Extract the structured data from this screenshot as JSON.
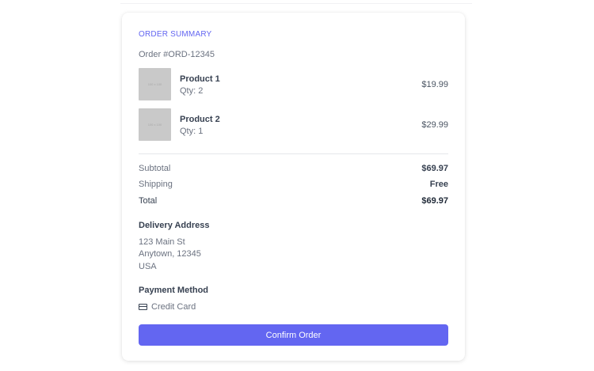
{
  "summary": {
    "heading": "ORDER SUMMARY",
    "order_id": "Order #ORD-12345"
  },
  "items": [
    {
      "name": "Product 1",
      "qty": "Qty: 2",
      "price": "$19.99",
      "thumb_text": "100 x 100"
    },
    {
      "name": "Product 2",
      "qty": "Qty: 1",
      "price": "$29.99",
      "thumb_text": "100 x 100"
    }
  ],
  "totals": {
    "subtotal_label": "Subtotal",
    "subtotal_value": "$69.97",
    "shipping_label": "Shipping",
    "shipping_value": "Free",
    "total_label": "Total",
    "total_value": "$69.97"
  },
  "delivery": {
    "title": "Delivery Address",
    "lines": [
      "123 Main St",
      "Anytown, 12345",
      "USA"
    ]
  },
  "payment": {
    "title": "Payment Method",
    "method": "Credit Card",
    "icon": "credit-card-icon"
  },
  "actions": {
    "confirm_label": "Confirm Order"
  },
  "colors": {
    "accent": "#6366f1",
    "thumb_placeholder": "#c9c9c9"
  }
}
